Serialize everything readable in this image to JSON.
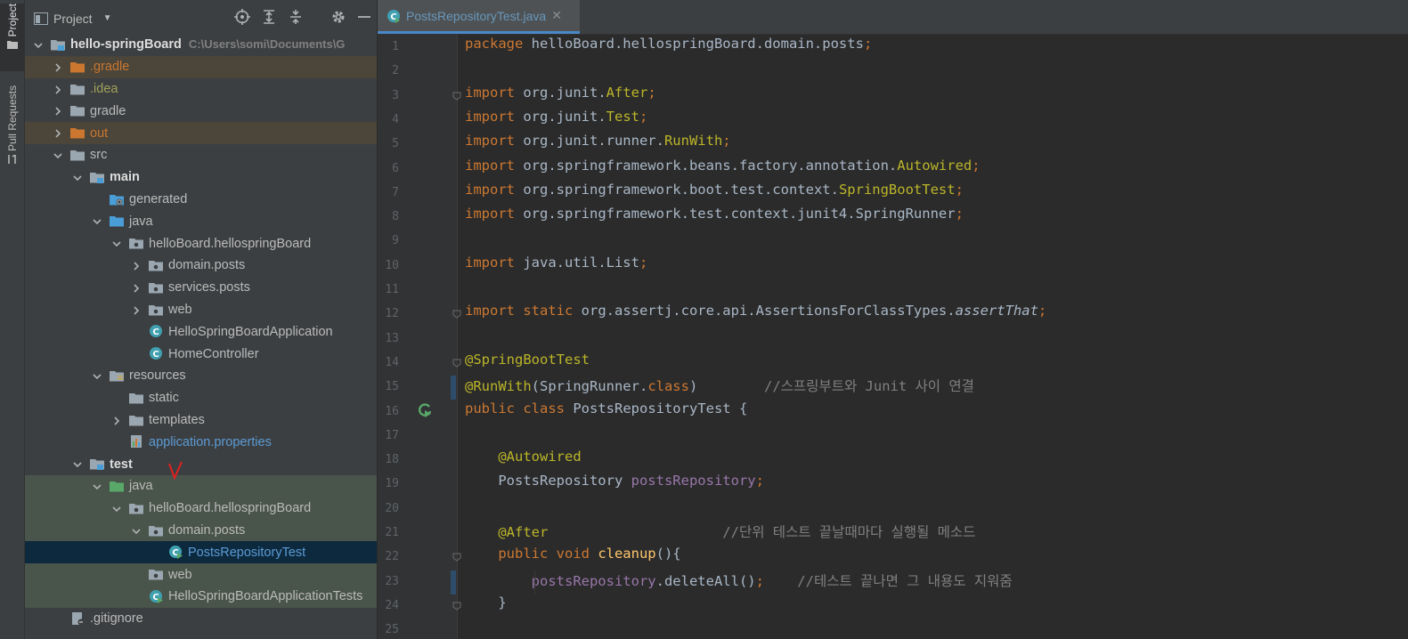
{
  "stripe": {
    "project_tab": "Project",
    "pull_requests_tab": "Pull Requests"
  },
  "panel": {
    "title": "Project"
  },
  "tree": [
    {
      "label": "hello-springBoard",
      "path": "C:\\Users\\somi\\Documents\\G",
      "depth": 0,
      "arrow": "down",
      "icon": "module-folder",
      "style": "bold"
    },
    {
      "label": ".gradle",
      "depth": 1,
      "arrow": "right",
      "icon": "folder-orange",
      "style": "orange",
      "bg": "excluded"
    },
    {
      "label": ".idea",
      "depth": 1,
      "arrow": "right",
      "icon": "folder",
      "style": "olive"
    },
    {
      "label": "gradle",
      "depth": 1,
      "arrow": "right",
      "icon": "folder",
      "style": ""
    },
    {
      "label": "out",
      "depth": 1,
      "arrow": "right",
      "icon": "folder-orange",
      "style": "orange",
      "bg": "excluded"
    },
    {
      "label": "src",
      "depth": 1,
      "arrow": "down",
      "icon": "folder",
      "style": ""
    },
    {
      "label": "main",
      "depth": 2,
      "arrow": "down",
      "icon": "module-folder",
      "style": "bold"
    },
    {
      "label": "generated",
      "depth": 3,
      "arrow": "",
      "icon": "generated-folder",
      "style": ""
    },
    {
      "label": "java",
      "depth": 3,
      "arrow": "down",
      "icon": "source-folder",
      "style": ""
    },
    {
      "label": "helloBoard.hellospringBoard",
      "depth": 4,
      "arrow": "down",
      "icon": "package",
      "style": ""
    },
    {
      "label": "domain.posts",
      "depth": 5,
      "arrow": "right",
      "icon": "package",
      "style": ""
    },
    {
      "label": "services.posts",
      "depth": 5,
      "arrow": "right",
      "icon": "package",
      "style": ""
    },
    {
      "label": "web",
      "depth": 5,
      "arrow": "right",
      "icon": "package",
      "style": ""
    },
    {
      "label": "HelloSpringBoardApplication",
      "depth": 5,
      "arrow": "",
      "icon": "class",
      "style": ""
    },
    {
      "label": "HomeController",
      "depth": 5,
      "arrow": "",
      "icon": "class",
      "style": ""
    },
    {
      "label": "resources",
      "depth": 3,
      "arrow": "down",
      "icon": "resources-folder",
      "style": ""
    },
    {
      "label": "static",
      "depth": 4,
      "arrow": "",
      "icon": "folder",
      "style": ""
    },
    {
      "label": "templates",
      "depth": 4,
      "arrow": "right",
      "icon": "folder",
      "style": ""
    },
    {
      "label": "application.properties",
      "depth": 4,
      "arrow": "",
      "icon": "properties",
      "style": "blue"
    },
    {
      "label": "test",
      "depth": 2,
      "arrow": "down",
      "icon": "module-folder",
      "style": "bold"
    },
    {
      "label": "java",
      "depth": 3,
      "arrow": "down",
      "icon": "test-folder",
      "style": "",
      "bg": "testbg"
    },
    {
      "label": "helloBoard.hellospringBoard",
      "depth": 4,
      "arrow": "down",
      "icon": "package",
      "style": "",
      "bg": "testbg"
    },
    {
      "label": "domain.posts",
      "depth": 5,
      "arrow": "down",
      "icon": "package",
      "style": "",
      "bg": "testbg"
    },
    {
      "label": "PostsRepositoryTest",
      "depth": 6,
      "arrow": "",
      "icon": "test-class",
      "style": "blue",
      "bg": "selected"
    },
    {
      "label": "web",
      "depth": 5,
      "arrow": "",
      "icon": "package",
      "style": "",
      "bg": "testbg"
    },
    {
      "label": "HelloSpringBoardApplicationTests",
      "depth": 5,
      "arrow": "",
      "icon": "test-class",
      "style": "",
      "bg": "testbg"
    },
    {
      "label": ".gitignore",
      "depth": 1,
      "arrow": "",
      "icon": "gitignore",
      "style": ""
    }
  ],
  "editor": {
    "tab_name": "PostsRepositoryTest.java",
    "tab_close": "✕",
    "lines": [
      [
        [
          "kw",
          "package "
        ],
        [
          "",
          "helloBoard.hellospringBoard.domain.posts"
        ],
        [
          "kw",
          ";"
        ]
      ],
      [],
      [
        [
          "kw",
          "import "
        ],
        [
          "",
          "org.junit."
        ],
        [
          "an",
          "After"
        ],
        [
          "kw",
          ";"
        ]
      ],
      [
        [
          "kw",
          "import "
        ],
        [
          "",
          "org.junit."
        ],
        [
          "an",
          "Test"
        ],
        [
          "kw",
          ";"
        ]
      ],
      [
        [
          "kw",
          "import "
        ],
        [
          "",
          "org.junit.runner."
        ],
        [
          "an",
          "RunWith"
        ],
        [
          "kw",
          ";"
        ]
      ],
      [
        [
          "kw",
          "import "
        ],
        [
          "",
          "org.springframework.beans.factory.annotation."
        ],
        [
          "an",
          "Autowired"
        ],
        [
          "kw",
          ";"
        ]
      ],
      [
        [
          "kw",
          "import "
        ],
        [
          "",
          "org.springframework.boot.test.context."
        ],
        [
          "an",
          "SpringBootTest"
        ],
        [
          "kw",
          ";"
        ]
      ],
      [
        [
          "kw",
          "import "
        ],
        [
          "",
          "org.springframework.test.context.junit4.SpringRunner"
        ],
        [
          "kw",
          ";"
        ]
      ],
      [],
      [
        [
          "kw",
          "import "
        ],
        [
          "",
          "java.util.List"
        ],
        [
          "kw",
          ";"
        ]
      ],
      [],
      [
        [
          "kw",
          "import static "
        ],
        [
          "",
          "org.assertj.core.api.AssertionsForClassTypes."
        ],
        [
          "it",
          "assertThat"
        ],
        [
          "kw",
          ";"
        ]
      ],
      [],
      [
        [
          "an",
          "@SpringBootTest"
        ]
      ],
      [
        [
          "an",
          "@RunWith"
        ],
        [
          "",
          "(SpringRunner."
        ],
        [
          "kw",
          "class"
        ],
        [
          "",
          ")        "
        ],
        [
          "cm",
          "//스프링부트와 Junit 사이 연결"
        ]
      ],
      [
        [
          "kw",
          "public class "
        ],
        [
          "",
          "PostsRepositoryTest {"
        ]
      ],
      [],
      [
        [
          "",
          "    "
        ],
        [
          "an",
          "@Autowired"
        ]
      ],
      [
        [
          "",
          "    PostsRepository "
        ],
        [
          "fd",
          "postsRepository"
        ],
        [
          "kw",
          ";"
        ]
      ],
      [],
      [
        [
          "",
          "    "
        ],
        [
          "an",
          "@After"
        ],
        [
          "",
          "                     "
        ],
        [
          "cm",
          "//단위 테스트 끝날때마다 실행될 메소드"
        ]
      ],
      [
        [
          "",
          "    "
        ],
        [
          "kw",
          "public void "
        ],
        [
          "mt",
          "cleanup"
        ],
        [
          "",
          "(){"
        ]
      ],
      [
        [
          "",
          "        "
        ],
        [
          "fd",
          "postsRepository"
        ],
        [
          "",
          ".deleteAll()"
        ],
        [
          "kw",
          ";"
        ],
        [
          "",
          "    "
        ],
        [
          "cm",
          "//테스트 끝나면 그 내용도 지워줌"
        ]
      ],
      [
        [
          "",
          "    }"
        ]
      ],
      []
    ]
  },
  "colors": {
    "accent": "#4a88c7",
    "selection": "#0d293e",
    "excluded": "#4b453a",
    "test_bg": "#49544a"
  }
}
